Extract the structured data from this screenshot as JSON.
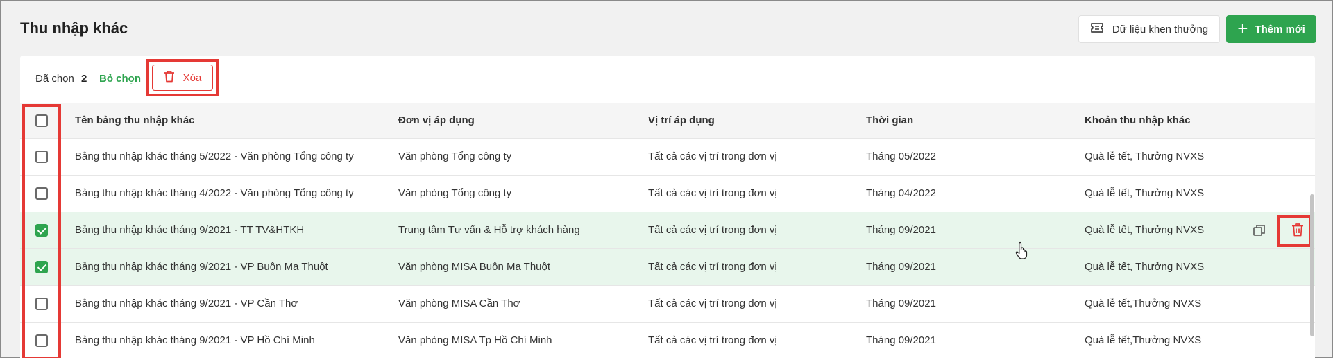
{
  "page": {
    "title": "Thu nhập khác"
  },
  "header_actions": {
    "reward_data_label": "Dữ liệu khen thưởng",
    "reward_icon": "ticket-icon",
    "add_new_label": "Thêm mới",
    "add_icon": "plus-icon"
  },
  "selection_bar": {
    "selected_label": "Đã chọn",
    "selected_count": "2",
    "deselect_label": "Bỏ chọn",
    "delete_label": "Xóa",
    "delete_icon": "trash-icon"
  },
  "table": {
    "columns": [
      "Tên bảng thu nhập khác",
      "Đơn vị áp dụng",
      "Vị trí áp dụng",
      "Thời gian",
      "Khoản thu nhập khác"
    ],
    "rows": [
      {
        "name": "Bảng thu nhập khác tháng 5/2022 - Văn phòng Tổng công ty",
        "unit": "Văn phòng Tổng công ty",
        "position": "Tất cả các vị trí trong đơn vị",
        "time": "Tháng 05/2022",
        "income": "Quà lễ tết, Thưởng NVXS",
        "checked": false
      },
      {
        "name": "Bảng thu nhập khác tháng 4/2022 - Văn phòng Tổng công ty",
        "unit": "Văn phòng Tổng công ty",
        "position": "Tất cả các vị trí trong đơn vị",
        "time": "Tháng 04/2022",
        "income": "Quà lễ tết, Thưởng NVXS",
        "checked": false
      },
      {
        "name": "Bảng thu nhập khác tháng 9/2021 - TT TV&HTKH",
        "unit": "Trung tâm Tư vấn & Hỗ trợ khách hàng",
        "position": "Tất cả các vị trí trong đơn vị",
        "time": "Tháng 09/2021",
        "income": "Quà lễ tết, Thưởng NVXS",
        "checked": true
      },
      {
        "name": "Bảng thu nhập khác tháng 9/2021 - VP Buôn Ma Thuột",
        "unit": "Văn phòng MISA Buôn Ma Thuột",
        "position": "Tất cả các vị trí trong đơn vị",
        "time": "Tháng 09/2021",
        "income": "Quà lễ tết, Thưởng NVXS",
        "checked": true
      },
      {
        "name": "Bảng thu nhập khác tháng 9/2021 - VP Cần Thơ",
        "unit": "Văn phòng MISA Cần Thơ",
        "position": "Tất cả các vị trí trong đơn vị",
        "time": "Tháng 09/2021",
        "income": "Quà lễ tết,Thưởng NVXS",
        "checked": false
      },
      {
        "name": "Bảng thu nhập khác tháng 9/2021 - VP Hồ Chí Minh",
        "unit": "Văn phòng MISA Tp Hồ Chí Minh",
        "position": "Tất cả các vị trí trong đơn vị",
        "time": "Tháng 09/2021",
        "income": "Quà lễ tết,Thưởng NVXS",
        "checked": false
      }
    ],
    "row_actions": {
      "copy_icon": "copy-icon",
      "delete_icon": "trash-icon"
    }
  },
  "colors": {
    "accent_green": "#2ea44f",
    "danger_red": "#e53935",
    "selected_row_bg": "#e8f6ec"
  }
}
